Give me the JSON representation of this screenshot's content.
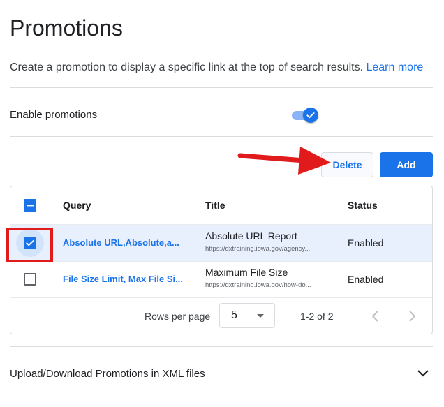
{
  "header": {
    "title": "Promotions",
    "description": "Create a promotion to display a specific link at the top of search results.",
    "learn_more": "Learn more"
  },
  "settings": {
    "enable_label": "Enable promotions",
    "enabled": true
  },
  "toolbar": {
    "delete_label": "Delete",
    "add_label": "Add"
  },
  "table": {
    "columns": [
      "Query",
      "Title",
      "Status"
    ],
    "header_checkbox_state": "indeterminate",
    "rows": [
      {
        "query": "Absolute URL,Absolute,a...",
        "title": "Absolute URL Report",
        "url": "https://dxtraining.iowa.gov/agency...",
        "status": "Enabled",
        "selected": true
      },
      {
        "query": "File Size Limit, Max File Si...",
        "title": "Maximum File Size",
        "url": "https://dxtraining.iowa.gov/how-do...",
        "status": "Enabled",
        "selected": false
      }
    ],
    "pagination": {
      "rows_per_page_label": "Rows per page",
      "rows_per_page": "5",
      "range": "1-2 of 2"
    }
  },
  "upload_section": {
    "label": "Upload/Download Promotions in XML files"
  },
  "colors": {
    "accent": "#1a73e8",
    "annotation_red": "#e11b1b",
    "selected_row": "#e8f0fe"
  }
}
